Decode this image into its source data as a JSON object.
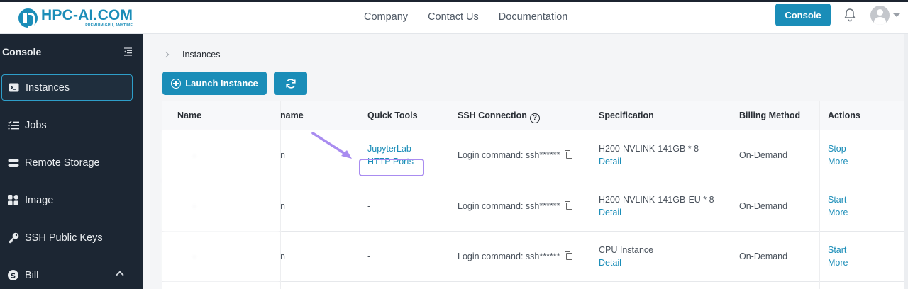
{
  "header": {
    "logo_name": "HPC-AI.COM",
    "logo_tag": "PREMIUM GPU, ANYTIME",
    "nav": [
      "Company",
      "Contact Us",
      "Documentation"
    ],
    "console_label": "Console"
  },
  "sidebar": {
    "title": "Console",
    "items": [
      {
        "label": "Instances",
        "icon": "terminal-icon",
        "active": true
      },
      {
        "label": "Jobs",
        "icon": "list-icon"
      },
      {
        "label": "Remote Storage",
        "icon": "storage-icon"
      },
      {
        "label": "Image",
        "icon": "grid-icon"
      },
      {
        "label": "SSH Public Keys",
        "icon": "key-icon"
      },
      {
        "label": "Bill",
        "icon": "dollar-icon"
      }
    ]
  },
  "main": {
    "breadcrumb": "Instances",
    "launch_label": "Launch Instance",
    "table": {
      "headers": {
        "name": "Name",
        "name_partial": "name",
        "quick_tools": "Quick Tools",
        "ssh": "SSH Connection",
        "spec": "Specification",
        "billing": "Billing Method",
        "actions": "Actions"
      },
      "rows": [
        {
          "name_frag": "n",
          "tool1": "JupyterLab",
          "tool2": "HTTP Ports",
          "ssh": "Login command: ssh******",
          "spec": "H200-NVLINK-141GB * 8",
          "detail": "Detail",
          "billing": "On-Demand",
          "action1": "Stop",
          "action2": "More"
        },
        {
          "name_frag": "n",
          "tool1": "-",
          "tool2": "",
          "ssh": "Login command: ssh******",
          "spec": "H200-NVLINK-141GB-EU * 8",
          "detail": "Detail",
          "billing": "On-Demand",
          "action1": "Start",
          "action2": "More"
        },
        {
          "name_frag": "n",
          "tool1": "-",
          "tool2": "",
          "ssh": "Login command: ssh******",
          "spec": "CPU Instance",
          "detail": "Detail",
          "billing": "On-Demand",
          "action1": "Start",
          "action2": "More"
        }
      ]
    }
  },
  "colors": {
    "accent": "#1a8db8",
    "sidebar_bg": "#1c2633",
    "highlight": "#a98cf0"
  }
}
